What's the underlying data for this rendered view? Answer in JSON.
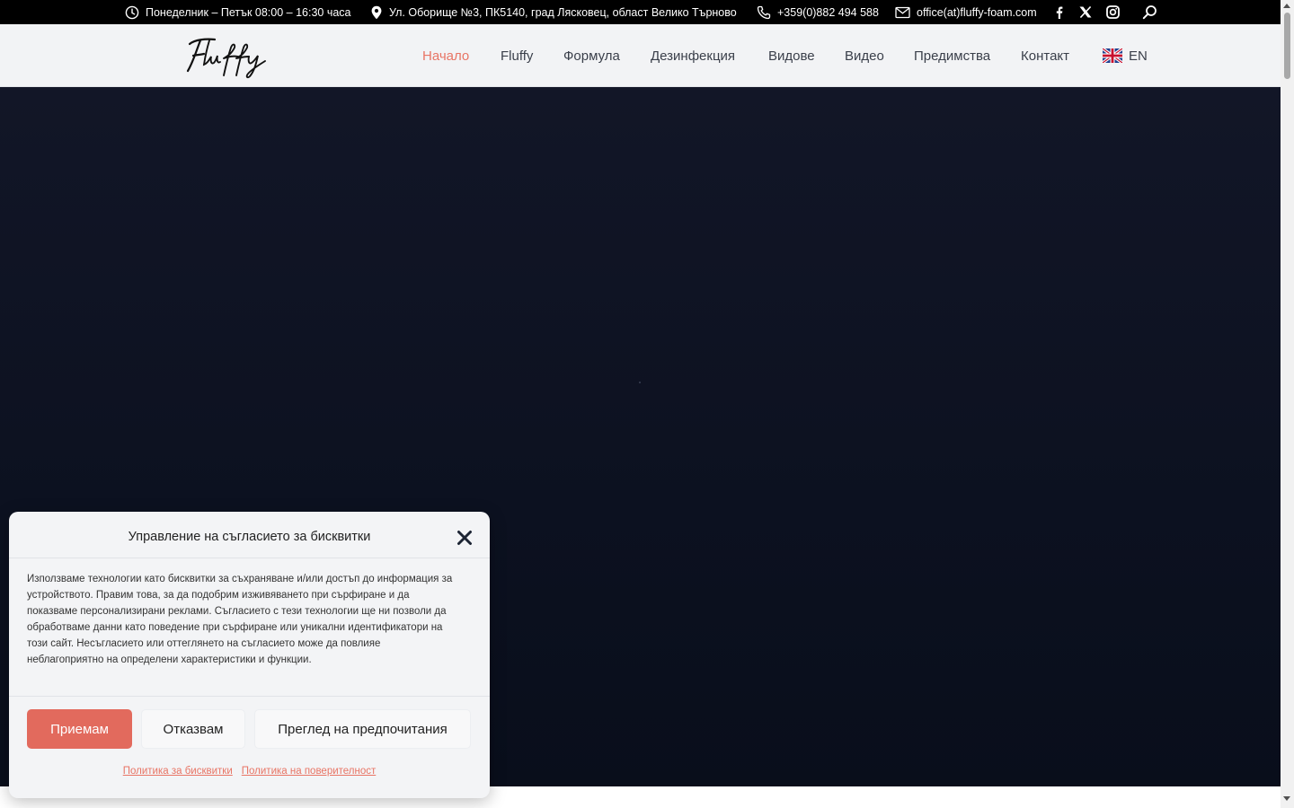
{
  "topbar": {
    "hours": "Понеделник – Петък 08:00 – 16:30 часа",
    "address": "Ул. Оборище №3, ПК5140, град Лясковец, област Велико Търново",
    "phone": "+359(0)882 494 588",
    "email": "office(at)fluffy-foam.com",
    "icons": [
      "clock-icon",
      "map-pin-icon",
      "phone-icon",
      "mail-icon",
      "facebook-icon",
      "x-icon",
      "instagram-icon",
      "search-icon"
    ]
  },
  "header": {
    "logo_text": "Fluffy",
    "nav": [
      {
        "label": "Начало",
        "active": true
      },
      {
        "label": "Fluffy",
        "active": false
      },
      {
        "label": "Формула",
        "active": false
      },
      {
        "label": "Дезинфекция",
        "active": false
      },
      {
        "label": "Видове",
        "active": false
      },
      {
        "label": "Видео",
        "active": false
      },
      {
        "label": "Предимства",
        "active": false
      },
      {
        "label": "Контакт",
        "active": false
      }
    ],
    "language": "EN"
  },
  "cookie": {
    "title": "Управление на съгласието за бисквитки",
    "body": "Използваме технологии като бисквитки за съхраняване и/или достъп до информация за устройството. Правим това, за да подобрим изживяването при сърфиране и да показваме персонализирани реклами. Съгласието с тези технологии ще ни позволи да обработваме данни като поведение при сърфиране или уникални идентификатори на този сайт. Несъгласието или оттеглянето на съгласието може да повлияе неблагоприятно на определени характеристики и функции.",
    "accept": "Приемам",
    "deny": "Отказвам",
    "preferences": "Преглед на предпочитания",
    "cookie_policy": "Политика за бисквитки",
    "privacy_policy": "Политика на поверителност"
  },
  "colors": {
    "accent": "#e87565",
    "accept_button": "#e26a5d",
    "hero_background": "#0d1222",
    "topbar": "#000000"
  }
}
